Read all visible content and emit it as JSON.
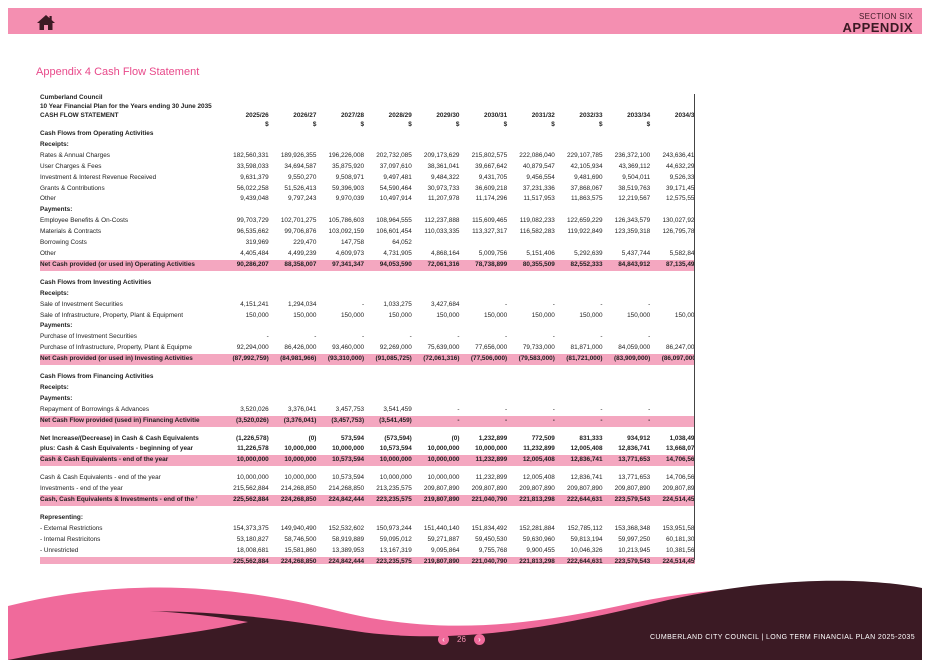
{
  "header": {
    "section_label": "SECTION SIX",
    "section_title": "APPENDIX"
  },
  "page_heading": "Appendix 4 Cash Flow Statement",
  "statement": {
    "org": "Cumberland Council",
    "plan": "10 Year Financial Plan for the Years ending 30 June 2035",
    "title": "CASH FLOW STATEMENT",
    "years": [
      "2025/26",
      "2026/27",
      "2027/28",
      "2028/29",
      "2029/30",
      "2030/31",
      "2031/32",
      "2032/33",
      "2033/34",
      "2034/35"
    ],
    "unit": "$",
    "rows": [
      {
        "type": "section",
        "label": "Cash Flows from Operating Activities",
        "values": []
      },
      {
        "type": "sub",
        "label": "Receipts:",
        "values": []
      },
      {
        "type": "plain",
        "label": "Rates & Annual Charges",
        "values": [
          "182,560,331",
          "189,926,355",
          "196,226,008",
          "202,732,085",
          "209,173,629",
          "215,802,575",
          "222,086,040",
          "229,107,785",
          "236,372,100",
          "243,636,416"
        ]
      },
      {
        "type": "plain",
        "label": "User Charges & Fees",
        "values": [
          "33,598,033",
          "34,694,587",
          "35,875,920",
          "37,097,610",
          "38,361,041",
          "39,667,642",
          "40,879,547",
          "42,105,934",
          "43,369,112",
          "44,632,290"
        ]
      },
      {
        "type": "plain",
        "label": "Investment & Interest Revenue Received",
        "values": [
          "9,631,379",
          "9,550,270",
          "9,508,971",
          "9,497,481",
          "9,484,322",
          "9,431,705",
          "9,456,554",
          "9,481,690",
          "9,504,011",
          "9,526,331"
        ]
      },
      {
        "type": "plain",
        "label": "Grants & Contributions",
        "values": [
          "56,022,258",
          "51,526,413",
          "59,396,903",
          "54,590,464",
          "30,973,733",
          "36,609,218",
          "37,231,336",
          "37,868,067",
          "38,519,763",
          "39,171,459"
        ]
      },
      {
        "type": "plain",
        "label": "Other",
        "values": [
          "9,439,048",
          "9,797,243",
          "9,970,039",
          "10,497,914",
          "11,207,978",
          "11,174,296",
          "11,517,953",
          "11,863,575",
          "12,219,567",
          "12,575,559"
        ]
      },
      {
        "type": "sub",
        "label": "Payments:",
        "values": []
      },
      {
        "type": "plain",
        "label": "Employee Benefits & On-Costs",
        "values": [
          "99,703,729",
          "102,701,275",
          "105,786,603",
          "108,964,555",
          "112,237,888",
          "115,609,465",
          "119,082,233",
          "122,659,229",
          "126,343,579",
          "130,027,929"
        ]
      },
      {
        "type": "plain",
        "label": "Materials & Contracts",
        "values": [
          "96,535,662",
          "99,706,876",
          "103,092,159",
          "106,601,454",
          "110,033,335",
          "113,327,317",
          "116,582,283",
          "119,922,849",
          "123,359,318",
          "126,795,787"
        ]
      },
      {
        "type": "plain",
        "label": "Borrowing Costs",
        "values": [
          "319,969",
          "229,470",
          "147,758",
          "64,052",
          "",
          "",
          "",
          "",
          "",
          ""
        ]
      },
      {
        "type": "plain",
        "label": "Other",
        "values": [
          "4,405,484",
          "4,499,239",
          "4,609,973",
          "4,731,905",
          "4,868,164",
          "5,009,756",
          "5,151,406",
          "5,292,639",
          "5,437,744",
          "5,582,848"
        ]
      },
      {
        "type": "total",
        "label": "Net Cash provided (or used in) Operating Activities",
        "values": [
          "90,286,207",
          "88,358,007",
          "97,341,347",
          "94,053,590",
          "72,061,316",
          "78,738,899",
          "80,355,509",
          "82,552,333",
          "84,843,912",
          "87,135,490"
        ]
      },
      {
        "type": "blank",
        "label": "",
        "values": []
      },
      {
        "type": "section",
        "label": "Cash Flows from Investing Activities",
        "values": []
      },
      {
        "type": "sub",
        "label": "Receipts:",
        "values": []
      },
      {
        "type": "plain",
        "label": "Sale of Investment Securities",
        "values": [
          "4,151,241",
          "1,294,034",
          "-",
          "1,033,275",
          "3,427,684",
          "-",
          "-",
          "-",
          "-",
          "-"
        ]
      },
      {
        "type": "plain",
        "label": "Sale of Infrastructure, Property, Plant & Equipment",
        "values": [
          "150,000",
          "150,000",
          "150,000",
          "150,000",
          "150,000",
          "150,000",
          "150,000",
          "150,000",
          "150,000",
          "150,000"
        ]
      },
      {
        "type": "sub",
        "label": "Payments:",
        "values": []
      },
      {
        "type": "plain",
        "label": "Purchase of Investment Securities",
        "values": [
          "-",
          "-",
          "-",
          "-",
          "-",
          "-",
          "-",
          "-",
          "-",
          "-"
        ]
      },
      {
        "type": "plain",
        "label": "Purchase of Infrastructure, Property, Plant & Equipme",
        "values": [
          "92,294,000",
          "86,426,000",
          "93,460,000",
          "92,269,000",
          "75,639,000",
          "77,656,000",
          "79,733,000",
          "81,871,000",
          "84,059,000",
          "86,247,000"
        ]
      },
      {
        "type": "total",
        "label": "Net Cash provided (or used in) Investing Activities",
        "values": [
          "(87,992,759)",
          "(84,981,966)",
          "(93,310,000)",
          "(91,085,725)",
          "(72,061,316)",
          "(77,506,000)",
          "(79,583,000)",
          "(81,721,000)",
          "(83,909,000)",
          "(86,097,000)"
        ]
      },
      {
        "type": "blank",
        "label": "",
        "values": []
      },
      {
        "type": "section",
        "label": "Cash Flows from Financing Activities",
        "values": []
      },
      {
        "type": "sub",
        "label": "Receipts:",
        "values": []
      },
      {
        "type": "sub",
        "label": "Payments:",
        "values": []
      },
      {
        "type": "plain",
        "label": "Repayment of Borrowings & Advances",
        "values": [
          "3,520,026",
          "3,376,041",
          "3,457,753",
          "3,541,459",
          "-",
          "-",
          "-",
          "-",
          "-",
          "-"
        ]
      },
      {
        "type": "total",
        "label": "Net Cash Flow provided (used in) Financing Activitie",
        "values": [
          "(3,520,026)",
          "(3,376,041)",
          "(3,457,753)",
          "(3,541,459)",
          "-",
          "-",
          "-",
          "-",
          "-",
          "-"
        ]
      },
      {
        "type": "blank",
        "label": "",
        "values": []
      },
      {
        "type": "boldrow",
        "label": "Net Increase/(Decrease) in Cash & Cash Equivalents",
        "values": [
          "(1,226,578)",
          "(0)",
          "573,594",
          "(573,594)",
          "(0)",
          "1,232,899",
          "772,509",
          "831,333",
          "934,912",
          "1,038,490"
        ]
      },
      {
        "type": "boldrow",
        "label": "plus: Cash & Cash Equivalents - beginning of year",
        "values": [
          "11,226,578",
          "10,000,000",
          "10,000,000",
          "10,573,594",
          "10,000,000",
          "10,000,000",
          "11,232,899",
          "12,005,408",
          "12,836,741",
          "13,668,074"
        ]
      },
      {
        "type": "total",
        "label": "Cash & Cash Equivalents - end of the year",
        "values": [
          "10,000,000",
          "10,000,000",
          "10,573,594",
          "10,000,000",
          "10,000,000",
          "11,232,899",
          "12,005,408",
          "12,836,741",
          "13,771,653",
          "14,706,564"
        ]
      },
      {
        "type": "blank",
        "label": "",
        "values": []
      },
      {
        "type": "plain",
        "label": "Cash & Cash Equivalents - end of the year",
        "values": [
          "10,000,000",
          "10,000,000",
          "10,573,594",
          "10,000,000",
          "10,000,000",
          "11,232,899",
          "12,005,408",
          "12,836,741",
          "13,771,653",
          "14,706,564"
        ]
      },
      {
        "type": "plain",
        "label": "Investments - end of the year",
        "values": [
          "215,562,884",
          "214,268,850",
          "214,268,850",
          "213,235,575",
          "209,807,890",
          "209,807,890",
          "209,807,890",
          "209,807,890",
          "209,807,890",
          "209,807,890"
        ]
      },
      {
        "type": "total",
        "label": "Cash, Cash Equivalents & Investments - end of the ’",
        "values": [
          "225,562,884",
          "224,268,850",
          "224,842,444",
          "223,235,575",
          "219,807,890",
          "221,040,790",
          "221,813,298",
          "222,644,631",
          "223,579,543",
          "224,514,455"
        ]
      },
      {
        "type": "blank",
        "label": "",
        "values": []
      },
      {
        "type": "section",
        "label": "Representing:",
        "values": []
      },
      {
        "type": "plain",
        "label": "- External Restrictions",
        "values": [
          "154,373,375",
          "149,940,490",
          "152,532,602",
          "150,973,244",
          "151,440,140",
          "151,834,492",
          "152,281,884",
          "152,785,112",
          "153,368,348",
          "153,951,584"
        ]
      },
      {
        "type": "plain",
        "label": "- Internal Restricitons",
        "values": [
          "53,180,827",
          "58,746,500",
          "58,919,889",
          "59,095,012",
          "59,271,887",
          "59,450,530",
          "59,630,960",
          "59,813,194",
          "59,997,250",
          "60,181,306"
        ]
      },
      {
        "type": "plain",
        "label": "- Unrestricted",
        "values": [
          "18,008,681",
          "15,581,860",
          "13,389,953",
          "13,167,319",
          "9,095,864",
          "9,755,768",
          "9,900,455",
          "10,046,326",
          "10,213,945",
          "10,381,565"
        ]
      },
      {
        "type": "total",
        "label": "",
        "values": [
          "225,562,884",
          "224,268,850",
          "224,842,444",
          "223,235,575",
          "219,807,890",
          "221,040,790",
          "221,813,298",
          "222,644,631",
          "223,579,543",
          "224,514,455"
        ]
      }
    ]
  },
  "footer": {
    "page_number": "26",
    "prev_glyph": "‹",
    "next_glyph": "›",
    "text": "CUMBERLAND CITY COUNCIL | LONG TERM FINANCIAL PLAN 2025-2035"
  },
  "colors": {
    "brand_pink": "#f48fb1",
    "accent_pink": "#e8498a",
    "dark_maroon": "#3b1a24",
    "total_row_fill": "#f4a7c0"
  },
  "icons": {
    "home": "home-icon"
  }
}
